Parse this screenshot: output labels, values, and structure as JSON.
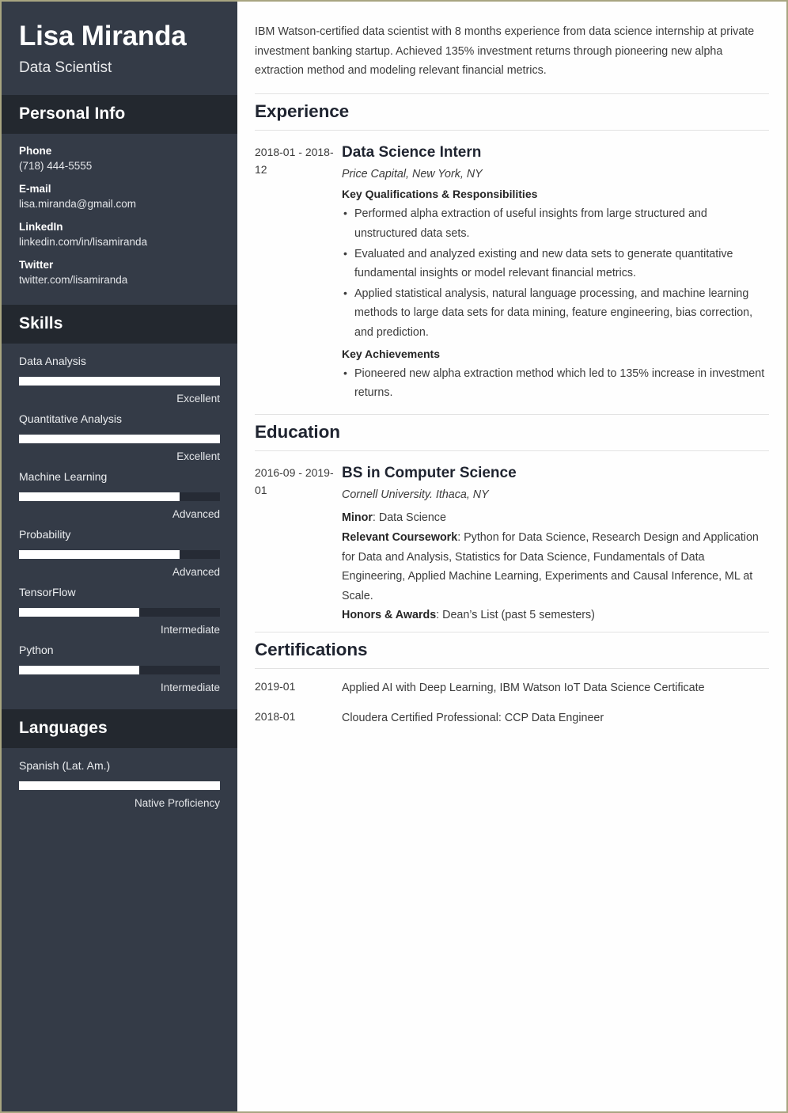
{
  "sidebar": {
    "full_name": "Lisa Miranda",
    "job_title": "Data Scientist",
    "personal_info": {
      "heading": "Personal Info",
      "items": [
        {
          "label": "Phone",
          "value": "(718) 444-5555"
        },
        {
          "label": "E-mail",
          "value": "lisa.miranda@gmail.com"
        },
        {
          "label": "LinkedIn",
          "value": "linkedin.com/in/lisamiranda"
        },
        {
          "label": "Twitter",
          "value": "twitter.com/lisamiranda"
        }
      ]
    },
    "skills": {
      "heading": "Skills",
      "items": [
        {
          "name": "Data Analysis",
          "level": "Excellent",
          "percent": 100
        },
        {
          "name": "Quantitative Analysis",
          "level": "Excellent",
          "percent": 100
        },
        {
          "name": "Machine Learning",
          "level": "Advanced",
          "percent": 80
        },
        {
          "name": "Probability",
          "level": "Advanced",
          "percent": 80
        },
        {
          "name": "TensorFlow",
          "level": "Intermediate",
          "percent": 60
        },
        {
          "name": "Python",
          "level": "Intermediate",
          "percent": 60
        }
      ]
    },
    "languages": {
      "heading": "Languages",
      "items": [
        {
          "name": "Spanish (Lat. Am.)",
          "level": "Native Proficiency",
          "percent": 100
        }
      ]
    }
  },
  "main": {
    "summary": "IBM Watson-certified data scientist with 8 months experience from data science internship at private investment banking startup. Achieved 135% investment returns through pioneering new alpha extraction method and modeling relevant financial metrics.",
    "experience": {
      "heading": "Experience",
      "entries": [
        {
          "dates": "2018-01 - 2018-12",
          "role": "Data Science Intern",
          "org": "Price Capital, New York, NY",
          "qualifications_heading": "Key Qualifications & Responsibilities",
          "qualifications": [
            "Performed alpha extraction of useful insights from large structured and unstructured data sets.",
            "Evaluated and analyzed existing and new data sets to generate quantitative fundamental insights or model relevant financial metrics.",
            "Applied statistical analysis, natural language processing, and machine learning methods to large data sets for data mining, feature engineering, bias correction, and prediction."
          ],
          "achievements_heading": "Key Achievements",
          "achievements": [
            "Pioneered new alpha extraction method which led to 135% increase in investment returns."
          ]
        }
      ]
    },
    "education": {
      "heading": "Education",
      "entries": [
        {
          "dates": "2016-09 - 2019-01",
          "degree": "BS in Computer Science",
          "school": "Cornell University. Ithaca, NY",
          "minor_label": "Minor",
          "minor_value": ": Data Science",
          "coursework_label": "Relevant Coursework",
          "coursework_value": ": Python for Data Science, Research Design and Application for Data and Analysis, Statistics for Data Science, Fundamentals of Data Engineering, Applied Machine Learning, Experiments and Causal Inference, ML at Scale.",
          "honors_label": "Honors & Awards",
          "honors_value": ": Dean’s List (past 5 semesters)"
        }
      ]
    },
    "certifications": {
      "heading": "Certifications",
      "entries": [
        {
          "date": "2019-01",
          "text": "Applied AI with Deep Learning, IBM Watson IoT Data Science Certificate"
        },
        {
          "date": "2018-01",
          "text": "Cloudera Certified Professional: CCP Data Engineer"
        }
      ]
    }
  }
}
